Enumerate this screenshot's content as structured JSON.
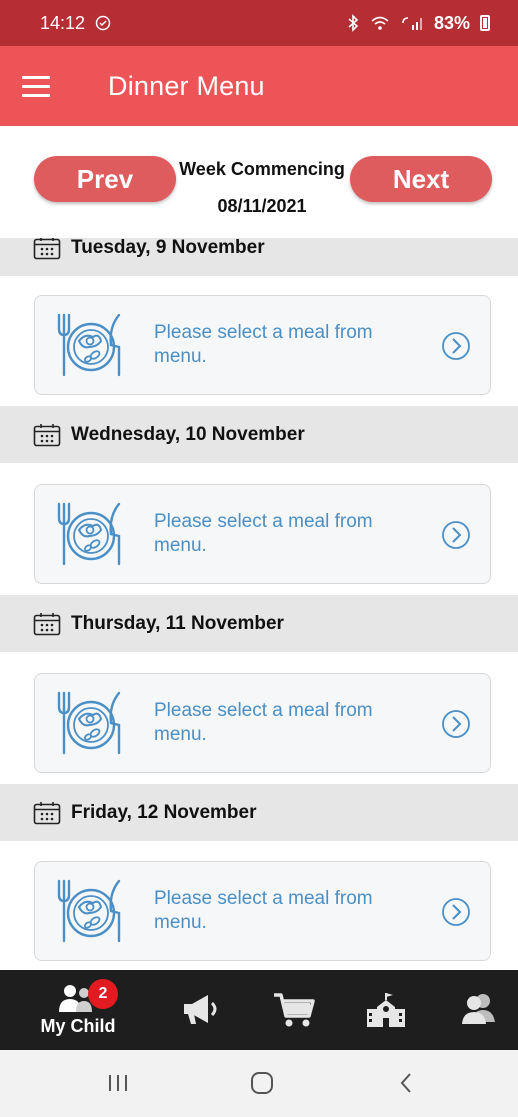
{
  "status_bar": {
    "time": "14:12",
    "battery": "83%"
  },
  "app_bar": {
    "title": "Dinner Menu"
  },
  "week_nav": {
    "prev_label": "Prev",
    "next_label": "Next",
    "week_label": "Week Commencing",
    "week_date": "08/11/2021"
  },
  "days": [
    {
      "name": "Tuesday, 9 November",
      "meal_text": "Please select a meal from menu."
    },
    {
      "name": "Wednesday, 10 November",
      "meal_text": "Please select a meal from menu."
    },
    {
      "name": "Thursday, 11 November",
      "meal_text": "Please select a meal from menu."
    },
    {
      "name": "Friday, 12 November",
      "meal_text": "Please select a meal from menu."
    }
  ],
  "bottom_nav": {
    "my_child_label": "My Child",
    "my_child_badge": "2",
    "tabs": [
      "my-child-icon",
      "megaphone-icon",
      "cart-icon",
      "school-icon",
      "contacts-icon"
    ]
  },
  "colors": {
    "status_bar": "#b52e33",
    "app_bar": "#ed5457",
    "nav_button": "#df5c5e",
    "meal_text": "#4a8fc6",
    "day_header": "#e6e6e6",
    "bottom_nav": "#1e1e1e",
    "badge": "#e21b23"
  }
}
